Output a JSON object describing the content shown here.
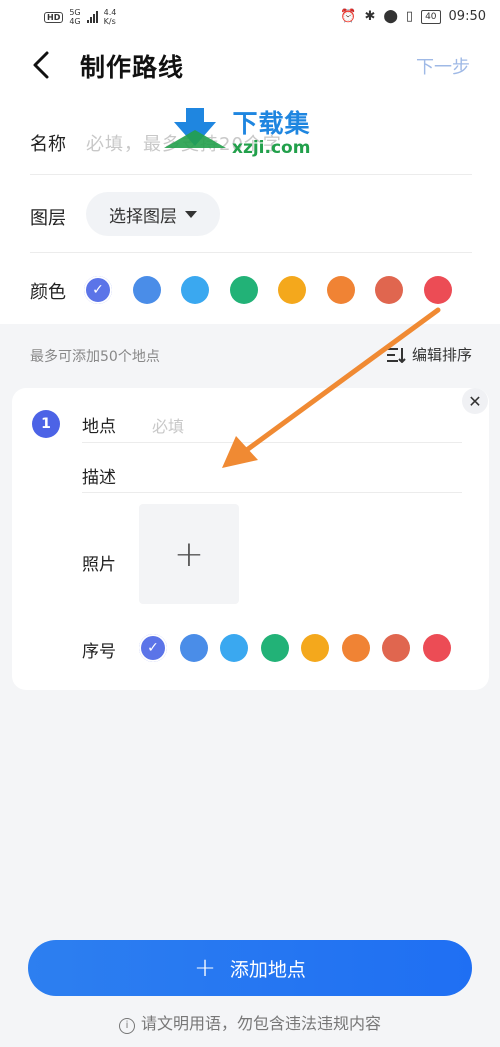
{
  "status_bar": {
    "network": "HD",
    "gen_top": "5G",
    "gen_bottom": "4G",
    "speed_value": "4.4",
    "speed_unit": "K/s",
    "battery": "40",
    "time": "09:50"
  },
  "header": {
    "title": "制作路线",
    "next_label": "下一步"
  },
  "watermark": {
    "cn": "下载集",
    "en": "xzji.com"
  },
  "form": {
    "name_label": "名称",
    "name_placeholder": "必填，最多支持20个字",
    "layer_label": "图层",
    "layer_button": "选择图层",
    "color_label": "颜色",
    "colors": [
      "#5b74e8",
      "#4a8de8",
      "#3aa8f0",
      "#22b277",
      "#f4a81c",
      "#f08334",
      "#e0664f",
      "#ec4c55"
    ],
    "selected_color_index": 0
  },
  "places": {
    "hint": "最多可添加50个地点",
    "sort_label": "编辑排序",
    "item": {
      "number": "1",
      "place_label": "地点",
      "place_placeholder": "必填",
      "desc_label": "描述",
      "photo_label": "照片",
      "order_label": "序号"
    }
  },
  "footer": {
    "add_button": "添加地点",
    "notice": "请文明用语，勿包含违法违规内容"
  }
}
